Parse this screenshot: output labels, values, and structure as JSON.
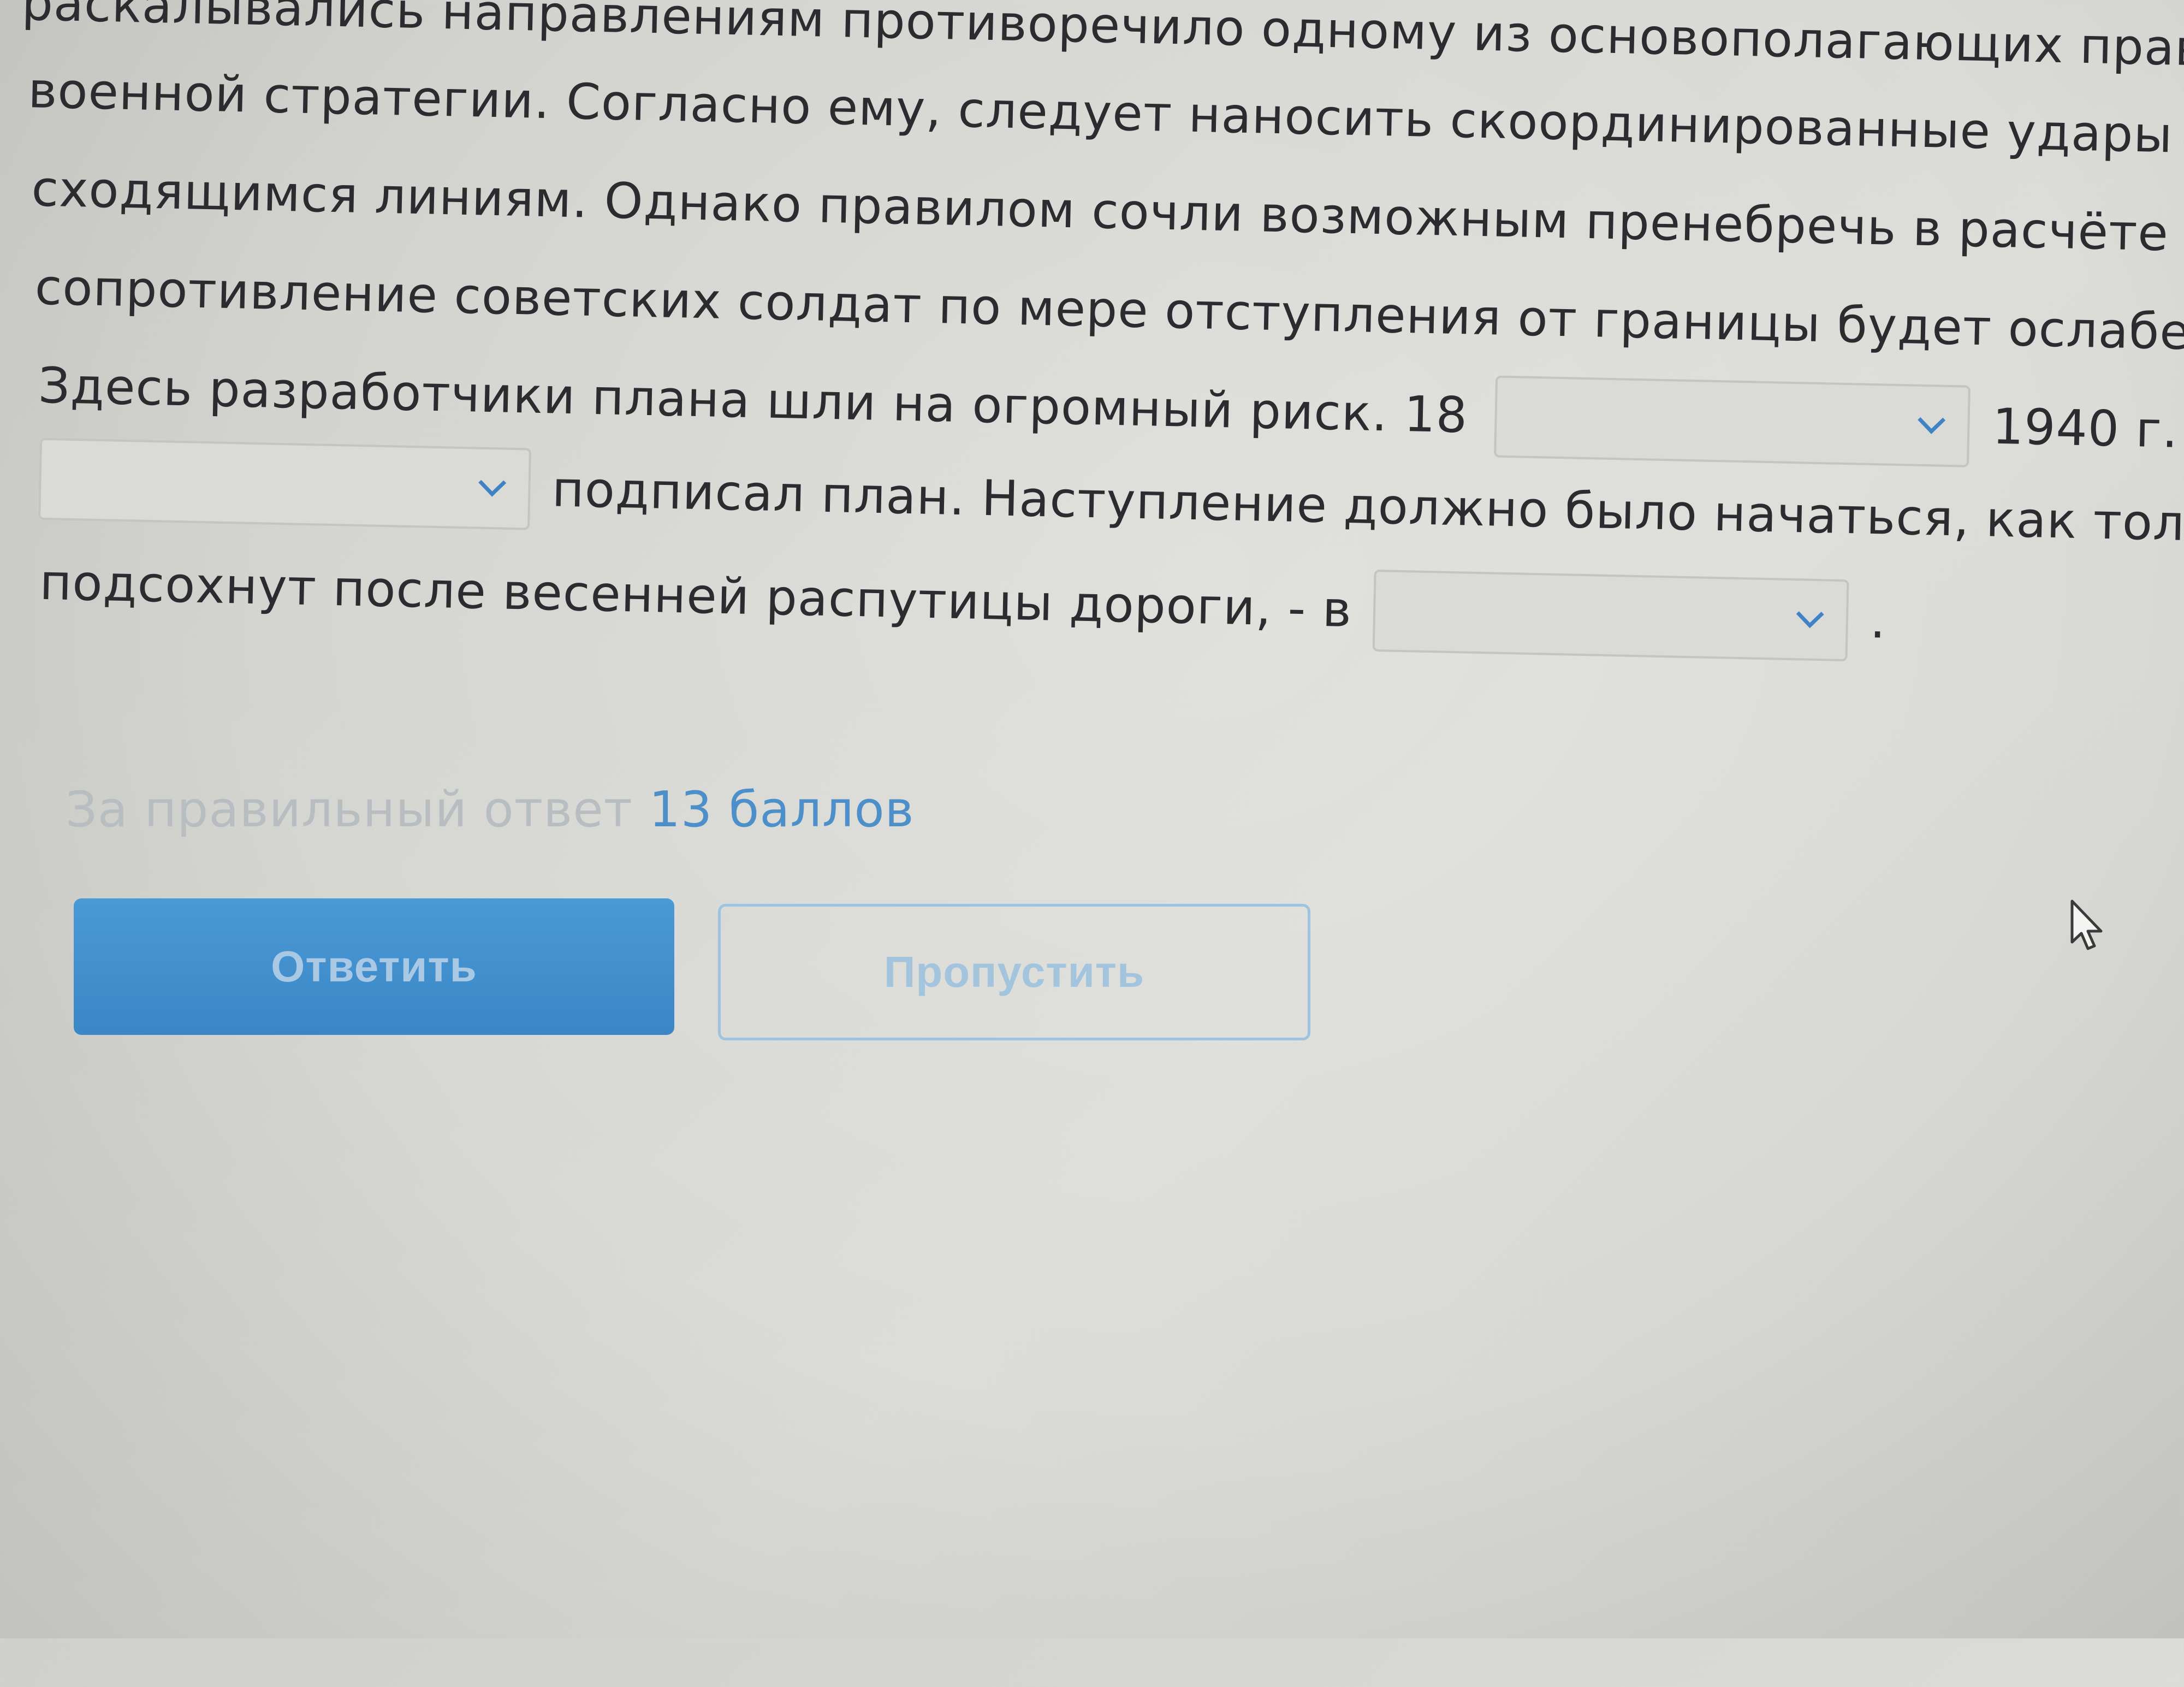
{
  "question": {
    "line1": "раскалывались направлениям противоречило одному из основополагающих правил",
    "line2": "военной стратегии. Согласно ему, следует наносить скоординированные удары по",
    "line3": "сходящимся линиям. Однако правилом сочли возможным пренебречь в расчёте на то,",
    "line4": "сопротивление советских солдат по мере отступления от границы будет ослабевать.",
    "line5_before": "Здесь разработчики плана шли на огромный риск. 18",
    "line5_after": "1940 г.",
    "line6_after": "подписал план. Наступление должно было начаться, как только",
    "line7_before": "подсохнут после весенней распутицы дороги, - в",
    "line7_after": "."
  },
  "dropdowns": {
    "month": {
      "selected": ""
    },
    "signer": {
      "selected": ""
    },
    "start_month": {
      "selected": ""
    }
  },
  "score": {
    "prefix": "За правильный ответ",
    "points": "13 баллов"
  },
  "buttons": {
    "answer_label": "Ответить",
    "skip_label": "Пропустить"
  },
  "colors": {
    "accent": "#3f82c5",
    "primary_button": "#3a86c6"
  }
}
